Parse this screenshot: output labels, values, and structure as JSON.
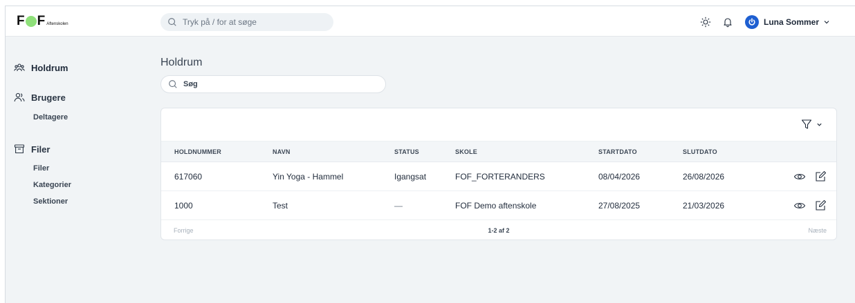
{
  "brand": {
    "logo_letter_1": "F",
    "logo_letter_2": "F",
    "logo_sub": "Aftenskolen",
    "accent": "#8fe07a"
  },
  "topbar": {
    "search_placeholder": "Tryk på / for at søge",
    "icons": [
      "search-icon",
      "sun-icon",
      "bell-icon",
      "power-icon",
      "chevron-down-icon"
    ],
    "user_name": "Luna Sommer"
  },
  "sidebar": {
    "sections": [
      {
        "label": "Holdrum",
        "icon": "team-icon"
      },
      {
        "label": "Brugere",
        "icon": "users-icon",
        "items": [
          "Deltagere"
        ]
      },
      {
        "label": "Filer",
        "icon": "archive-icon",
        "items": [
          "Filer",
          "Kategorier",
          "Sektioner"
        ]
      }
    ]
  },
  "main": {
    "title": "Holdrum",
    "search_placeholder": "Søg",
    "table": {
      "columns": [
        "HOLDNUMMER",
        "NAVN",
        "STATUS",
        "SKOLE",
        "STARTDATO",
        "SLUTDATO"
      ],
      "rows": [
        [
          "617060",
          "Yin Yoga - Hammel",
          "Igangsat",
          "FOF_FORTERANDERS",
          "08/04/2026",
          "26/08/2026"
        ],
        [
          "1000",
          "Test",
          "—",
          "FOF Demo aftenskole",
          "27/08/2025",
          "21/03/2026"
        ]
      ]
    },
    "pager": {
      "prev": "Forrige",
      "count": "1-2 af 2",
      "next": "Næste"
    }
  }
}
